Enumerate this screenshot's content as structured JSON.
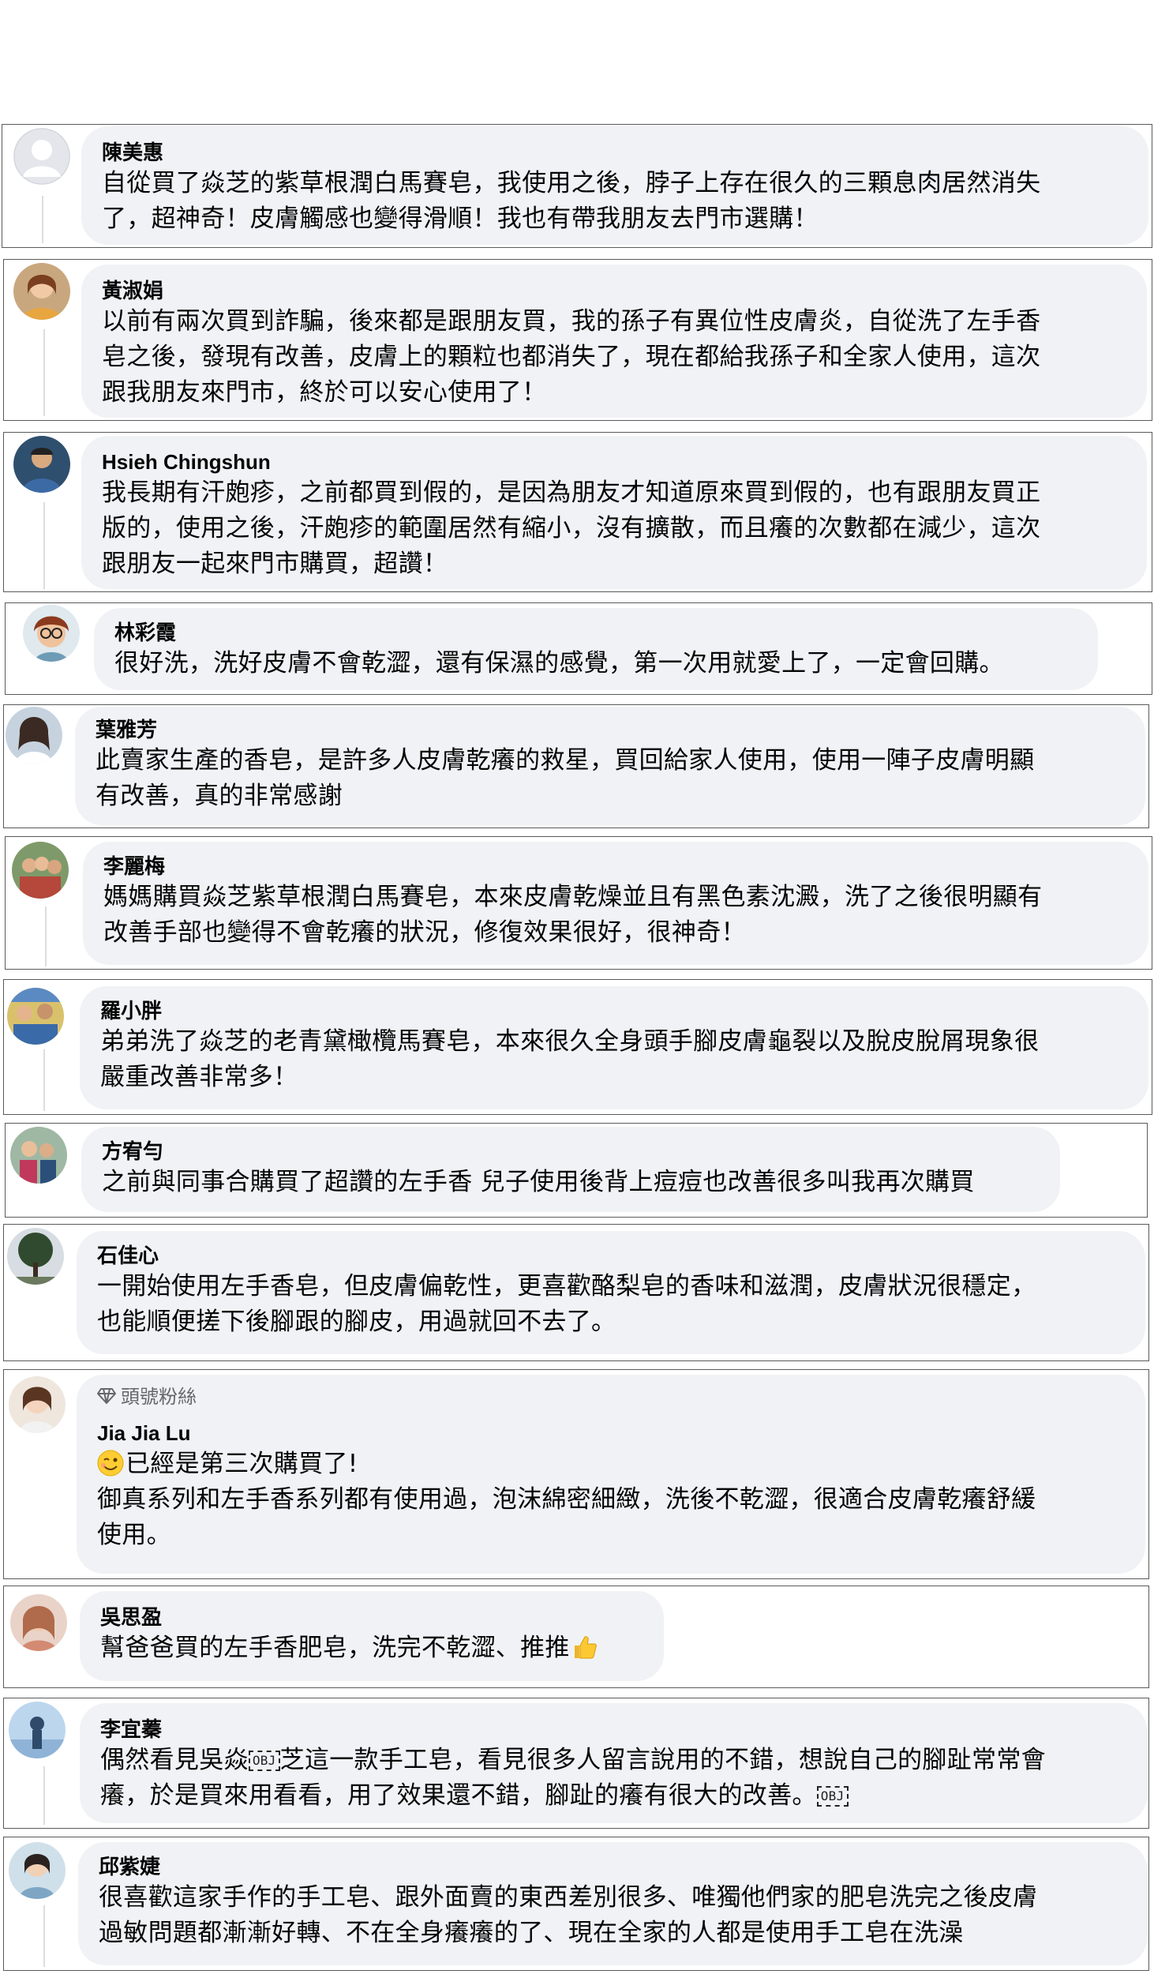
{
  "comments": [
    {
      "name": "陳美惠",
      "lines": [
        "自從買了焱芝的紫草根潤白馬賽皂，我使用之後，脖子上存在很久的三顆息肉居然消失",
        "了，超神奇！皮膚觸感也變得滑順！我也有帶我朋友去門市選購！"
      ],
      "avatar": "default-person-avatar"
    },
    {
      "name": "黃淑娟",
      "lines": [
        "以前有兩次買到詐騙，後來都是跟朋友買，我的孫子有異位性皮膚炎，自從洗了左手香",
        "皂之後，發現有改善，皮膚上的顆粒也都消失了，現在都給我孫子和全家人使用，這次",
        "跟我朋友來門市，終於可以安心使用了！"
      ],
      "avatar": "woman-avatar"
    },
    {
      "name": "Hsieh Chingshun",
      "lines": [
        "我長期有汗皰疹，之前都買到假的，是因為朋友才知道原來買到假的，也有跟朋友買正",
        "版的，使用之後，汗皰疹的範圍居然有縮小，沒有擴散，而且癢的次數都在減少，這次",
        "跟朋友一起來門市購買，超讚！"
      ],
      "avatar": "man-avatar"
    },
    {
      "name": "林彩霞",
      "lines": [
        "很好洗，洗好皮膚不會乾澀，還有保濕的感覺，第一次用就愛上了，一定會回購。"
      ],
      "avatar": "cartoon-avatar"
    },
    {
      "name": "葉雅芳",
      "lines": [
        "此賣家生產的香皂，是許多人皮膚乾癢的救星，買回給家人使用，使用一陣子皮膚明顯",
        "有改善，真的非常感謝"
      ],
      "avatar": "woman-avatar"
    },
    {
      "name": "李麗梅",
      "lines": [
        "媽媽購買焱芝紫草根潤白馬賽皂，本來皮膚乾燥並且有黑色素沈澱，洗了之後很明顯有",
        "改善手部也變得不會乾癢的狀況，修復效果很好，很神奇！"
      ],
      "avatar": "group-avatar"
    },
    {
      "name": "羅小胖",
      "lines": [
        "弟弟洗了焱芝的老青黛橄欖馬賽皂，本來很久全身頭手腳皮膚龜裂以及脫皮脫屑現象很",
        "嚴重改善非常多！"
      ],
      "avatar": "group-avatar"
    },
    {
      "name": "方宥勻",
      "lines": [
        "之前與同事合購買了超讚的左手香 兒子使用後背上痘痘也改善很多叫我再次購買"
      ],
      "avatar": "family-avatar"
    },
    {
      "name": "石佳心",
      "lines": [
        "一開始使用左手香皂，但皮膚偏乾性，更喜歡酪梨皂的香味和滋潤，皮膚狀況很穩定，",
        "也能順便搓下後腳跟的腳皮，用過就回不去了。"
      ],
      "avatar": "tree-avatar"
    },
    {
      "name": "Jia Jia Lu",
      "badge": "頭號粉絲",
      "emoji_line": "已經是第三次購買了!",
      "lines": [
        "御真系列和左手香系列都有使用過，泡沫綿密細緻，洗後不乾澀，很適合皮膚乾癢舒緩",
        "使用。"
      ],
      "avatar": "woman-avatar"
    },
    {
      "name": "吳思盈",
      "lines": [
        "幫爸爸買的左手香肥皂，洗完不乾澀、推推"
      ],
      "avatar": "woman-avatar"
    },
    {
      "name": "李宜蓁",
      "line1_parts": [
        "偶然看見吳焱",
        "OBJ",
        "芝這一款手工皂，看見很多人留言說用的不錯，想說自己的腳趾常常會"
      ],
      "line2_parts": [
        "癢，於是買來用看看，用了效果還不錯，腳趾的癢有很大的改善。",
        "OBJ"
      ],
      "avatar": "outdoor-avatar"
    },
    {
      "name": "邱紫婕",
      "lines": [
        "很喜歡這家手作的手工皂、跟外面賣的東西差別很多、唯獨他們家的肥皂洗完之後皮膚",
        "過敏問題都漸漸好轉、不在全身癢癢的了、現在全家的人都是使用手工皂在洗澡"
      ],
      "avatar": "woman-avatar"
    }
  ],
  "colors": {
    "bubble": "#f0f2f5",
    "text": "#050505",
    "muted": "#65676b",
    "card_border": "#5a5a5a"
  }
}
